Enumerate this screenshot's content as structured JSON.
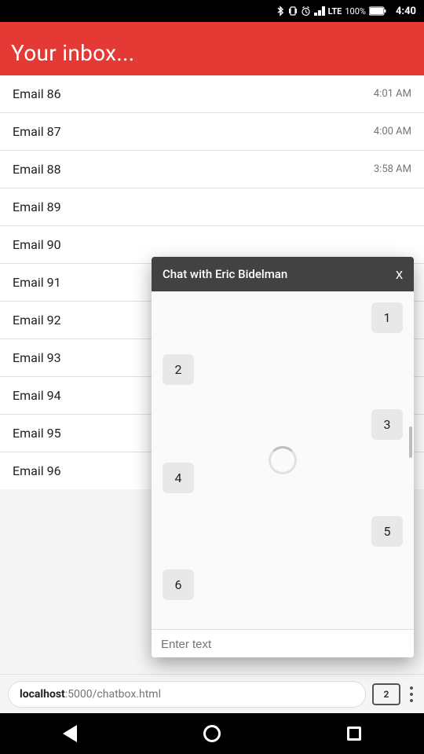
{
  "statusBar": {
    "time": "4:40",
    "battery": "100%"
  },
  "header": {
    "title": "Your inbox..."
  },
  "emails": [
    {
      "name": "Email  86",
      "time": "4:01 AM"
    },
    {
      "name": "Email  87",
      "time": "4:00 AM"
    },
    {
      "name": "Email  88",
      "time": "3:58 AM"
    },
    {
      "name": "Email  89",
      "time": ""
    },
    {
      "name": "Email  90",
      "time": ""
    },
    {
      "name": "Email  91",
      "time": ""
    },
    {
      "name": "Email  92",
      "time": ""
    },
    {
      "name": "Email  93",
      "time": ""
    },
    {
      "name": "Email  94",
      "time": ""
    },
    {
      "name": "Email  95",
      "time": ""
    },
    {
      "name": "Email  96",
      "time": ""
    }
  ],
  "chat": {
    "title": "Chat with Eric Bidelman",
    "closeLabel": "x",
    "messages": [
      {
        "id": "1",
        "side": "right",
        "text": "1"
      },
      {
        "id": "2",
        "side": "left",
        "text": "2"
      },
      {
        "id": "3",
        "side": "right",
        "text": "3"
      },
      {
        "id": "4",
        "side": "left",
        "text": "4"
      },
      {
        "id": "5",
        "side": "right",
        "text": "5"
      },
      {
        "id": "6",
        "side": "left",
        "text": "6"
      }
    ],
    "inputPlaceholder": "Enter text"
  },
  "browserBar": {
    "host": "localhost",
    "path": ":5000/chatbox.html",
    "tabCount": "2"
  }
}
